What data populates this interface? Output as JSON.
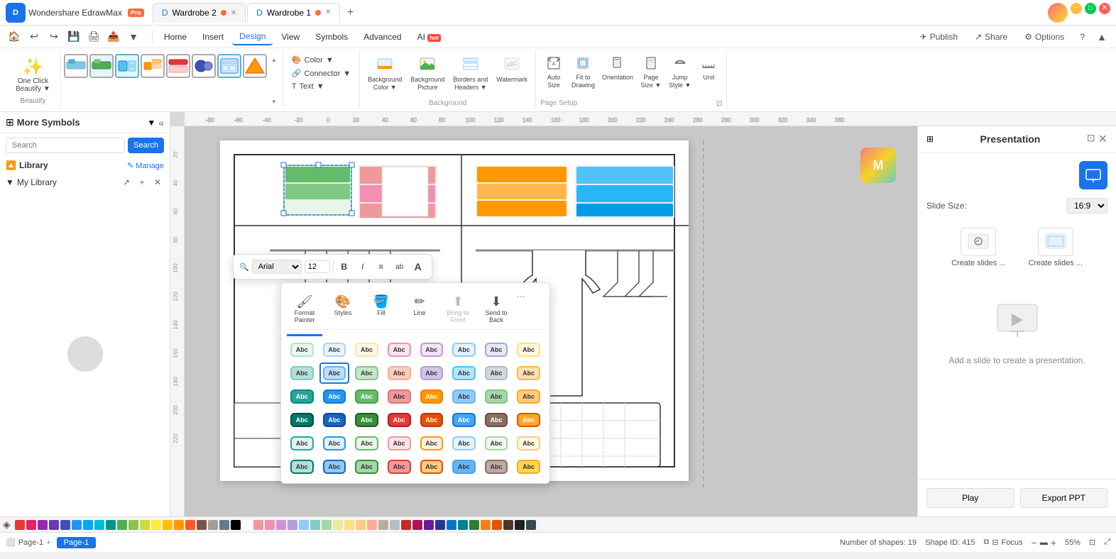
{
  "app": {
    "name": "Wondershare EdrawMax",
    "pro_badge": "Pro",
    "logo": "D"
  },
  "tabs": [
    {
      "label": "Wardrobe 2",
      "active": false,
      "dot": true
    },
    {
      "label": "Wardrobe 1",
      "active": true,
      "dot": true
    }
  ],
  "window_controls": {
    "minimize": "−",
    "maximize": "⬜",
    "close": "✕"
  },
  "quick_actions": [
    "↩",
    "↪",
    "💾",
    "🖨",
    "📤"
  ],
  "menu_items": [
    "Home",
    "Insert",
    "Design",
    "View",
    "Symbols",
    "Advanced",
    "AI"
  ],
  "active_menu": "Design",
  "header_actions": {
    "publish": "Publish",
    "share": "Share",
    "options": "Options",
    "help": "?"
  },
  "ribbon": {
    "beautify": {
      "label": "One Click\nBeautify",
      "arrow": "▼"
    },
    "shape_styles": [
      "style1",
      "style2",
      "style3",
      "style4",
      "style5",
      "style6",
      "style7",
      "style8",
      "style9",
      "style10",
      "style11",
      "style12",
      "style13",
      "style14",
      "style15",
      "style16"
    ],
    "format": {
      "color": "Color",
      "connector": "Connector",
      "text": "Text"
    },
    "background": {
      "color": {
        "icon": "🎨",
        "label": "Background\nColor",
        "arrow": "▼"
      },
      "picture": {
        "icon": "🖼",
        "label": "Background\nPicture"
      },
      "headers": {
        "icon": "📋",
        "label": "Borders and\nHeaders",
        "arrow": "▼"
      },
      "watermark": {
        "icon": "💧",
        "label": "Watermark"
      },
      "group_label": "Background"
    },
    "page_setup": {
      "auto_size": {
        "icon": "📏",
        "label": "Auto\nSize"
      },
      "fit_to_drawing": {
        "icon": "⬜",
        "label": "Fit to\nDrawing"
      },
      "orientation": {
        "icon": "📄",
        "label": "Orientation"
      },
      "page_size": {
        "icon": "📃",
        "label": "Page\nSize",
        "arrow": "▼"
      },
      "jump_style": {
        "icon": "↗",
        "label": "Jump\nStyle",
        "arrow": "▼"
      },
      "unit": {
        "icon": "📐",
        "label": "Unit"
      },
      "group_label": "Page Setup"
    }
  },
  "left_sidebar": {
    "title": "More Symbols",
    "search_placeholder": "Search",
    "search_btn": "Search",
    "library_label": "Library",
    "manage_label": "Manage",
    "my_library_label": "My Library"
  },
  "floating_toolbar": {
    "font": "Arial",
    "font_size": "12",
    "bold": "B",
    "italic": "I",
    "align": "≡",
    "style_ab": "ab",
    "text_a": "A"
  },
  "style_popup": {
    "tabs": [
      "Styles",
      "Fill",
      "Line"
    ],
    "active_tab": "Styles",
    "toolbar_items": [
      {
        "icon": "🖌",
        "label": "Format\nPainter"
      },
      {
        "icon": "🎨",
        "label": "Styles"
      },
      {
        "icon": "🪣",
        "label": "Fill"
      },
      {
        "icon": "✏",
        "label": "Line"
      },
      {
        "icon": "⬆",
        "label": "Bring to\nFront",
        "disabled": true
      },
      {
        "icon": "⬇",
        "label": "Send to\nBack"
      }
    ],
    "style_rows": [
      [
        {
          "text": "Abc",
          "bg": "#e8faf0",
          "border": "#aae6c4"
        },
        {
          "text": "Abc",
          "bg": "#e8f4fd",
          "border": "#aad4f5"
        },
        {
          "text": "Abc",
          "bg": "#fef9e7",
          "border": "#f9e79f"
        },
        {
          "text": "Abc",
          "bg": "#fce4ec",
          "border": "#f48fb1"
        },
        {
          "text": "Abc",
          "bg": "#f3e5f5",
          "border": "#ce93d8"
        },
        {
          "text": "Abc",
          "bg": "#e3f2fd",
          "border": "#90caf9"
        },
        {
          "text": "Abc",
          "bg": "#e8eaf6",
          "border": "#9fa8da"
        },
        {
          "text": "Abc",
          "bg": "#fff8e1",
          "border": "#ffe082"
        }
      ],
      [
        {
          "text": "Abc",
          "bg": "#b2dfdb",
          "border": "#80cbc4"
        },
        {
          "text": "Abc",
          "bg": "#bbdefb",
          "border": "#64b5f6",
          "selected": true
        },
        {
          "text": "Abc",
          "bg": "#c8e6c9",
          "border": "#81c784"
        },
        {
          "text": "Abc",
          "bg": "#ffccbc",
          "border": "#ffab91"
        },
        {
          "text": "Abc",
          "bg": "#d1c4e9",
          "border": "#b39ddb"
        },
        {
          "text": "Abc",
          "bg": "#b3e5fc",
          "border": "#4fc3f7"
        },
        {
          "text": "Abc",
          "bg": "#cfd8dc",
          "border": "#b0bec5"
        },
        {
          "text": "Abc",
          "bg": "#ffe0b2",
          "border": "#ffb74d"
        }
      ],
      [
        {
          "text": "Abc",
          "bg": "#26a69a",
          "border": "#00897b",
          "light": true
        },
        {
          "text": "Abc",
          "bg": "#2196f3",
          "border": "#1976d2",
          "light": true
        },
        {
          "text": "Abc",
          "bg": "#66bb6a",
          "border": "#43a047",
          "light": true
        },
        {
          "text": "Abc",
          "bg": "#ef9a9a",
          "border": "#e57373"
        },
        {
          "text": "Abc",
          "bg": "#ff9800",
          "border": "#f57c00",
          "light": true
        },
        {
          "text": "Abc",
          "bg": "#90caf9",
          "border": "#64b5f6"
        },
        {
          "text": "Abc",
          "bg": "#a5d6a7",
          "border": "#81c784"
        },
        {
          "text": "Abc",
          "bg": "#ffcc80",
          "border": "#ffa726"
        }
      ],
      [
        {
          "text": "Abc",
          "bg": "#00796b",
          "border": "#004d40",
          "light": true
        },
        {
          "text": "Abc",
          "bg": "#1565c0",
          "border": "#0d47a1",
          "light": true
        },
        {
          "text": "Abc",
          "bg": "#388e3c",
          "border": "#1b5e20",
          "light": true
        },
        {
          "text": "Abc",
          "bg": "#e53935",
          "border": "#b71c1c",
          "light": true
        },
        {
          "text": "Abc",
          "bg": "#e65100",
          "border": "#bf360c",
          "light": true
        },
        {
          "text": "Abc",
          "bg": "#42a5f5",
          "border": "#1976d2",
          "light": true
        },
        {
          "text": "Abc",
          "bg": "#8d6e63",
          "border": "#6d4c41",
          "light": true
        },
        {
          "text": "Abc",
          "bg": "#ffa726",
          "border": "#e65100",
          "light": true
        }
      ],
      [
        {
          "text": "Abc",
          "bg": "#e0f2f1",
          "border": "#26a69a"
        },
        {
          "text": "Abc",
          "bg": "#e3f2fd",
          "border": "#2196f3"
        },
        {
          "text": "Abc",
          "bg": "#e8f5e9",
          "border": "#66bb6a"
        },
        {
          "text": "Abc",
          "bg": "#fce4ec",
          "border": "#ef9a9a"
        },
        {
          "text": "Abc",
          "bg": "#fff3e0",
          "border": "#ff9800"
        },
        {
          "text": "Abc",
          "bg": "#e3f2fd",
          "border": "#90caf9"
        },
        {
          "text": "Abc",
          "bg": "#f1f8e9",
          "border": "#a5d6a7"
        },
        {
          "text": "Abc",
          "bg": "#fff8e1",
          "border": "#ffcc80"
        }
      ],
      [
        {
          "text": "Abc",
          "bg": "#b2dfdb",
          "border": "#00796b"
        },
        {
          "text": "Abc",
          "bg": "#90caf9",
          "border": "#1565c0"
        },
        {
          "text": "Abc",
          "bg": "#a5d6a7",
          "border": "#388e3c"
        },
        {
          "text": "Abc",
          "bg": "#ef9a9a",
          "border": "#e53935"
        },
        {
          "text": "Abc",
          "bg": "#ffcc80",
          "border": "#e65100"
        },
        {
          "text": "Abc",
          "bg": "#64b5f6",
          "border": "#42a5f5"
        },
        {
          "text": "Abc",
          "bg": "#bcaaa4",
          "border": "#8d6e63"
        },
        {
          "text": "Abc",
          "bg": "#ffd54f",
          "border": "#ffa726"
        }
      ]
    ]
  },
  "right_sidebar": {
    "title": "Presentation",
    "slide_size_label": "Slide Size:",
    "slide_size_value": "16:9",
    "create_slides_label1": "Create slides ...",
    "create_slides_label2": "Create slides ...",
    "empty_text": "Add a slide to create a presentation.",
    "play_btn": "Play",
    "export_btn": "Export PPT"
  },
  "status_bar": {
    "page_label": "Page-1",
    "page_tab": "Page-1",
    "shapes_info": "Number of shapes: 19",
    "shape_id": "Shape ID: 415",
    "focus_label": "Focus",
    "zoom_level": "55%"
  },
  "colors": [
    "#e53935",
    "#e91e63",
    "#9c27b0",
    "#673ab7",
    "#3f51b5",
    "#2196f3",
    "#03a9f4",
    "#00bcd4",
    "#009688",
    "#4caf50",
    "#8bc34a",
    "#cddc39",
    "#ffeb3b",
    "#ffc107",
    "#ff9800",
    "#ff5722",
    "#795548",
    "#9e9e9e",
    "#607d8b",
    "#000000",
    "#ffffff",
    "#ef9a9a",
    "#f48fb1",
    "#ce93d8",
    "#b39ddb",
    "#90caf9",
    "#80cbc4",
    "#a5d6a7",
    "#e6ee9c",
    "#ffe082",
    "#ffcc80",
    "#ffab91",
    "#bcaaa4",
    "#b0bec5",
    "#c62828",
    "#ad1457",
    "#6a1b9a",
    "#283593",
    "#0277bd",
    "#00838f",
    "#2e7d32",
    "#f57f17",
    "#e65100",
    "#4e342e",
    "#212121",
    "#37474f"
  ]
}
